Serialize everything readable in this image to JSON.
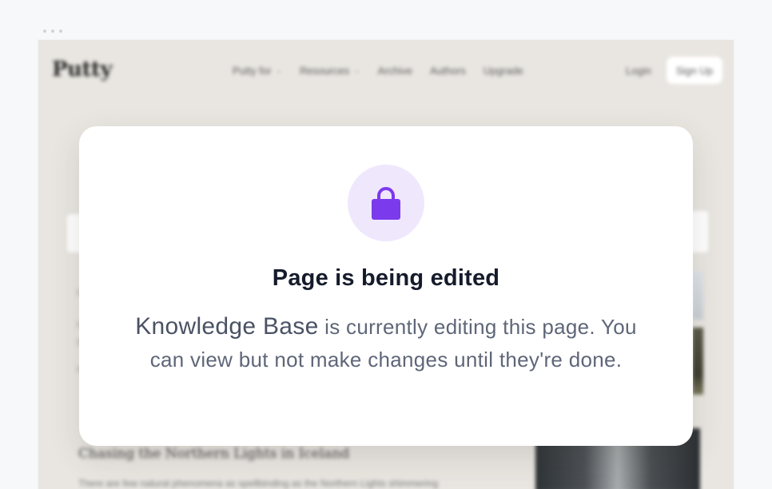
{
  "background_page": {
    "logo": "Putty",
    "nav": [
      {
        "label": "Putty for",
        "has_caret": true
      },
      {
        "label": "Resources",
        "has_caret": true
      },
      {
        "label": "Archive",
        "has_caret": false
      },
      {
        "label": "Authors",
        "has_caret": false
      },
      {
        "label": "Upgrade",
        "has_caret": false
      }
    ],
    "login_label": "Login",
    "signup_label": "Sign Up",
    "article_title": "Chasing the Northern Lights in Iceland",
    "article_excerpt": "There are few natural phenomena as spellbinding as the Northern Lights shimmering"
  },
  "modal": {
    "icon": "lock-icon",
    "title": "Page is being edited",
    "editor_name": "Knowledge Base",
    "message_part1": " is currently editing this page.",
    "message_part2": "You can view but not make changes until they're done."
  },
  "colors": {
    "accent": "#7c3aed",
    "icon_circle": "#efe8fd",
    "title": "#151b2b",
    "body_text": "#5e6678"
  }
}
